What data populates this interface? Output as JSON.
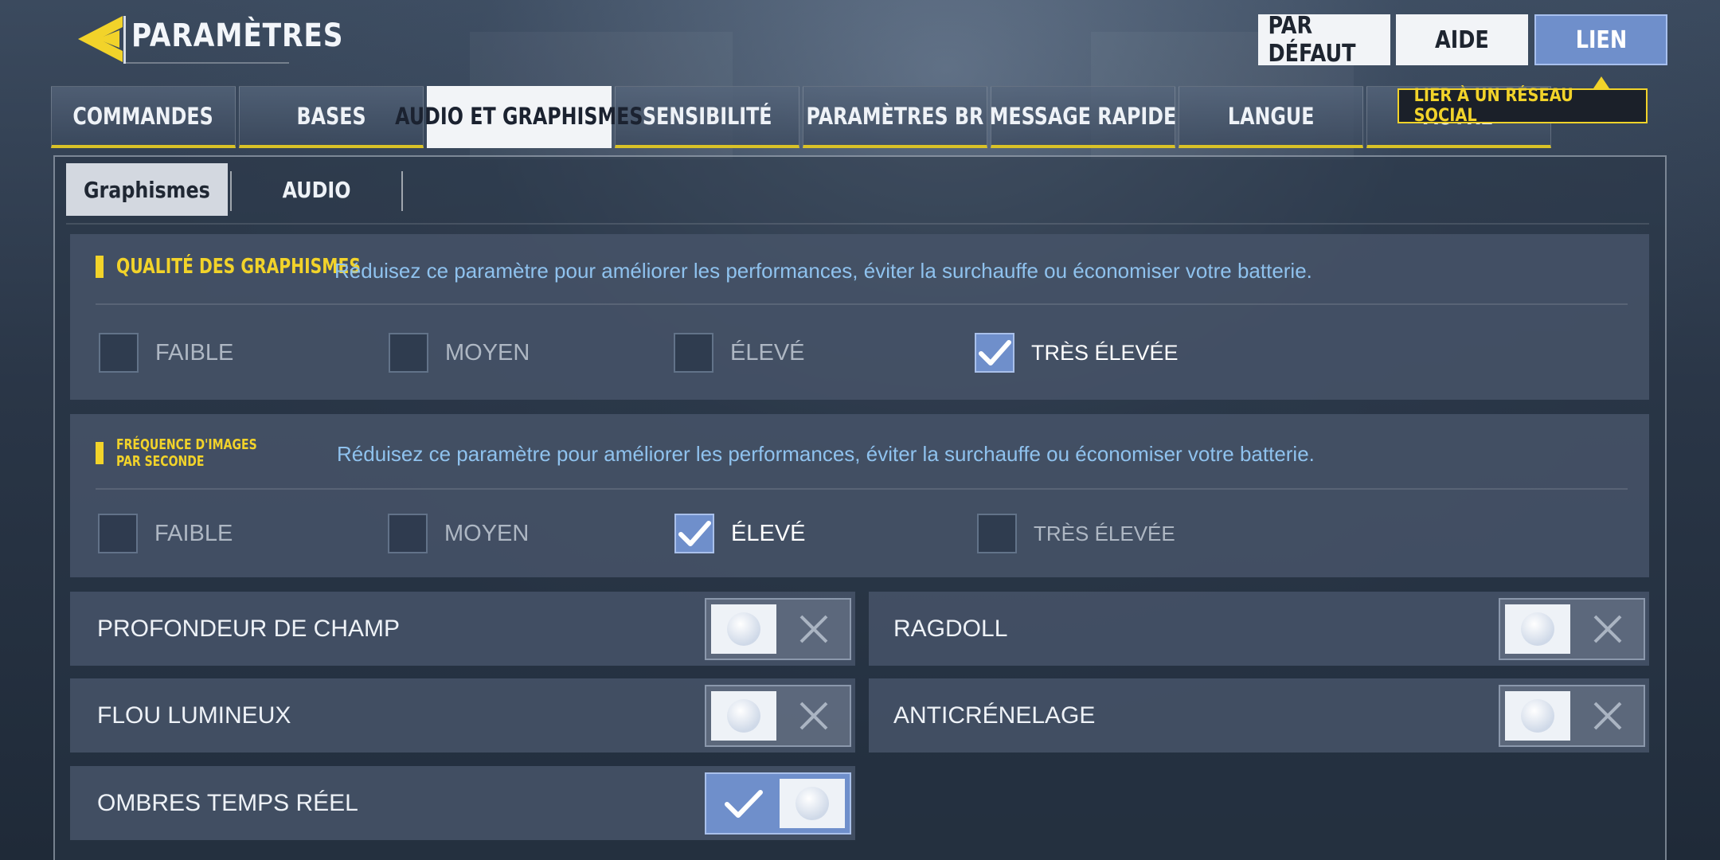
{
  "header": {
    "title": "PARAMÈTRES",
    "buttons": {
      "default": "PAR DÉFAUT",
      "help": "AIDE",
      "link": "LIEN"
    },
    "tooltip": "LIER À UN RÉSEAU SOCIAL"
  },
  "tabs": [
    {
      "label": "COMMANDES",
      "active": false
    },
    {
      "label": "BASES",
      "active": false
    },
    {
      "label": "AUDIO ET GRAPHISMES",
      "active": true
    },
    {
      "label": "SENSIBILITÉ",
      "active": false
    },
    {
      "label": "PARAMÈTRES BR",
      "active": false
    },
    {
      "label": "MESSAGE RAPIDE",
      "active": false
    },
    {
      "label": "LANGUE",
      "active": false
    },
    {
      "label": "AUTRE",
      "active": false
    }
  ],
  "subtabs": {
    "graphics": "Graphismes",
    "audio": "AUDIO",
    "active": "graphics"
  },
  "quality": {
    "title": "QUALITÉ DES GRAPHISMES",
    "description": "Réduisez ce paramètre pour améliorer les performances, éviter la surchauffe ou économiser votre batterie.",
    "options": [
      "FAIBLE",
      "MOYEN",
      "ÉLEVÉ",
      "TRÈS ÉLEVÉE"
    ],
    "selected": 3
  },
  "fps": {
    "title": "FRÉQUENCE D'IMAGES PAR SECONDE",
    "description": "Réduisez ce paramètre pour améliorer les performances, éviter la surchauffe ou économiser votre batterie.",
    "options": [
      "FAIBLE",
      "MOYEN",
      "ÉLEVÉ",
      "TRÈS ÉLEVÉE"
    ],
    "selected": 2
  },
  "toggles": {
    "depth_of_field": {
      "label": "PROFONDEUR DE CHAMP",
      "on": false
    },
    "ragdoll": {
      "label": "RAGDOLL",
      "on": false
    },
    "bloom": {
      "label": "FLOU LUMINEUX",
      "on": false
    },
    "antialiasing": {
      "label": "ANTICRÉNELAGE",
      "on": false
    },
    "realtime_shadows": {
      "label": "OMBRES TEMPS RÉEL",
      "on": true
    }
  },
  "colors": {
    "accent_yellow": "#f2d32a",
    "accent_blue": "#6f8fcb",
    "description_blue": "#8fc2ee"
  },
  "icons": {
    "logo": "back-arrow-logo-icon",
    "check": "checkmark-icon",
    "off": "x-mark-icon",
    "knob": "toggle-knob-icon"
  }
}
